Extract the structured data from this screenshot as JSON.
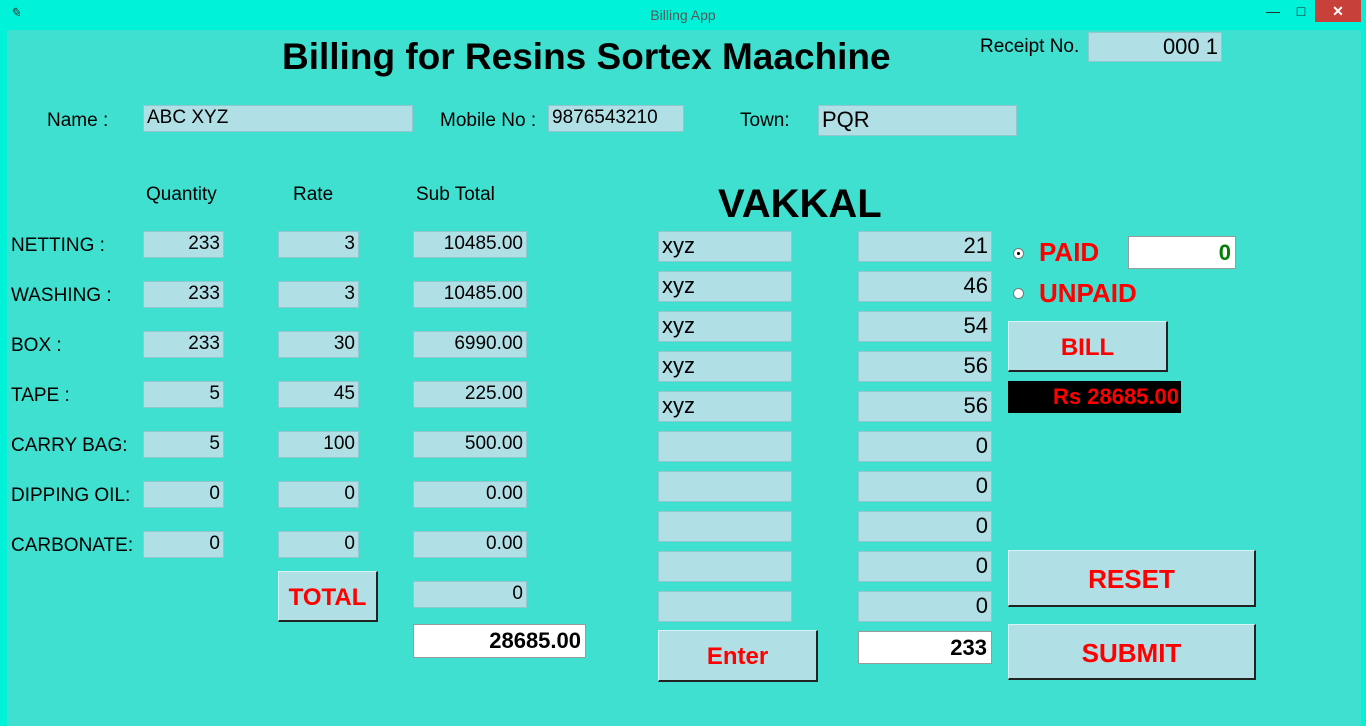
{
  "window": {
    "title": "Billing App",
    "icon": "feather-icon",
    "minimize": "—",
    "maximize": "□",
    "close": "✕"
  },
  "header": {
    "title": "Billing for Resins Sortex Maachine",
    "receipt_label": "Receipt No.",
    "receipt_value": "000 1"
  },
  "customer": {
    "name_label": "Name :",
    "name_value": "ABC XYZ",
    "mobile_label": "Mobile No :",
    "mobile_value": "9876543210",
    "town_label": "Town:",
    "town_value": "PQR"
  },
  "items_header": {
    "quantity": "Quantity",
    "rate": "Rate",
    "subtotal": "Sub Total"
  },
  "items": [
    {
      "label": "NETTING   :",
      "quantity": "233",
      "rate": "3",
      "subtotal": "10485.00"
    },
    {
      "label": "WASHING  :",
      "quantity": "233",
      "rate": "3",
      "subtotal": "10485.00"
    },
    {
      "label": "BOX          :",
      "quantity": "233",
      "rate": "30",
      "subtotal": "6990.00"
    },
    {
      "label": "TAPE         :",
      "quantity": "5",
      "rate": "45",
      "subtotal": "225.00"
    },
    {
      "label": "CARRY BAG:",
      "quantity": "5",
      "rate": "100",
      "subtotal": "500.00"
    },
    {
      "label": "DIPPING OIL:",
      "quantity": "0",
      "rate": "0",
      "subtotal": "0.00"
    },
    {
      "label": "CARBONATE:",
      "quantity": "0",
      "rate": "0",
      "subtotal": "0.00"
    }
  ],
  "total": {
    "button_label": "TOTAL",
    "extra_value": "0",
    "grand_total": "28685.00"
  },
  "vakkal": {
    "title": "VAKKAL",
    "rows": [
      {
        "name": "xyz",
        "value": "21"
      },
      {
        "name": "xyz",
        "value": "46"
      },
      {
        "name": "xyz",
        "value": "54"
      },
      {
        "name": "xyz",
        "value": "56"
      },
      {
        "name": "xyz",
        "value": "56"
      },
      {
        "name": "",
        "value": "0"
      },
      {
        "name": "",
        "value": "0"
      },
      {
        "name": "",
        "value": "0"
      },
      {
        "name": "",
        "value": "0"
      },
      {
        "name": "",
        "value": "0"
      }
    ],
    "enter_label": "Enter",
    "sum_value": "233"
  },
  "payment": {
    "paid_label": "PAID",
    "unpaid_label": "UNPAID",
    "paid_selected": true,
    "paid_amount": "0"
  },
  "bill": {
    "button_label": "BILL",
    "amount_text": "Rs 28685.00"
  },
  "actions": {
    "reset_label": "RESET",
    "submit_label": "SUBMIT"
  },
  "colors": {
    "background": "#40e0d0",
    "field": "#b0e0e6",
    "accent_red": "#ff0000",
    "paid_green": "#008000"
  }
}
